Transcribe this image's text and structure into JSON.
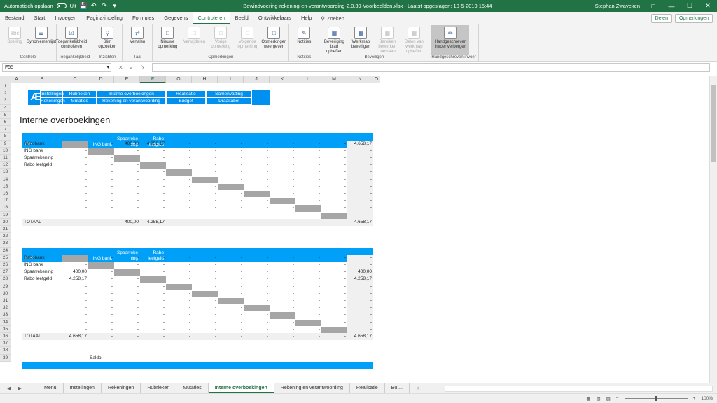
{
  "titlebar": {
    "autosave_label": "Automatisch opslaan",
    "autosave_state": "Uit",
    "file_title": "Bewindvoering-rekening-en-verantwoording-2.0.39-Voorbeelden.xlsx  -  Laatst opgeslagen: 10-5-2019 15:44",
    "user": "Stephan Zwaveken",
    "min": "—",
    "max": "☐",
    "close": "✕"
  },
  "menu": {
    "tabs": [
      "Bestand",
      "Start",
      "Invoegen",
      "Pagina-indeling",
      "Formules",
      "Gegevens",
      "Controleren",
      "Beeld",
      "Ontwikkelaars",
      "Help"
    ],
    "active": "Controleren",
    "search": "Zoeken",
    "share": "Delen",
    "comments": "Opmerkingen"
  },
  "ribbon": {
    "groups": [
      {
        "label": "Controle",
        "buttons": [
          {
            "label": "Spelling",
            "icon": "abc-icon",
            "disabled": true
          },
          {
            "label": "Synoniemenlijst",
            "icon": "book-icon"
          }
        ]
      },
      {
        "label": "Toegankelijkheid",
        "buttons": [
          {
            "label": "Toegankelijkheid controleren",
            "icon": "accessibility-icon"
          }
        ]
      },
      {
        "label": "Inzichten",
        "buttons": [
          {
            "label": "Slim opzoeken",
            "icon": "lookup-icon"
          }
        ]
      },
      {
        "label": "Taal",
        "buttons": [
          {
            "label": "Vertalen",
            "icon": "translate-icon"
          }
        ]
      },
      {
        "label": "Opmerkingen",
        "buttons": [
          {
            "label": "Nieuwe opmerking",
            "icon": "comment-icon"
          },
          {
            "label": "Verwijderen",
            "icon": "comment-icon",
            "disabled": true
          },
          {
            "label": "Vorige opmerking",
            "icon": "comment-icon",
            "disabled": true
          },
          {
            "label": "Volgende opmerking",
            "icon": "comment-icon",
            "disabled": true
          },
          {
            "label": "Opmerkingen weergeven",
            "icon": "comment-icon"
          }
        ]
      },
      {
        "label": "Notities",
        "buttons": [
          {
            "label": "Notities",
            "icon": "note-icon"
          }
        ]
      },
      {
        "label": "Beveiligen",
        "buttons": [
          {
            "label": "Beveiliging blad opheffen",
            "icon": "sheet-icon"
          },
          {
            "label": "Werkmap beveiligen",
            "icon": "sheet-icon"
          },
          {
            "label": "Bereiken bewerken toestaan",
            "icon": "sheet-icon",
            "disabled": true
          },
          {
            "label": "Delen van werkmap opheffen",
            "icon": "sheet-icon",
            "disabled": true
          }
        ]
      },
      {
        "label": "Handgeschreven invoer",
        "buttons": [
          {
            "label": "Handgeschreven invoer verbergen",
            "icon": "ink-icon",
            "selected": true
          }
        ]
      }
    ]
  },
  "formulabar": {
    "namebox": "F55",
    "cancel": "✕",
    "enter": "✓",
    "fx": "fx",
    "value": ""
  },
  "grid": {
    "columns": [
      "A",
      "B",
      "C",
      "D",
      "E",
      "F",
      "G",
      "H",
      "I",
      "J",
      "K",
      "L",
      "M",
      "N",
      "O"
    ],
    "selected_column": "F",
    "rows": [
      "1",
      "2",
      "3",
      "4",
      "5",
      "6",
      "7",
      "8",
      "9",
      "10",
      "11",
      "12",
      "13",
      "14",
      "15",
      "16",
      "17",
      "18",
      "19",
      "20",
      "21",
      "22",
      "23",
      "24",
      "25",
      "26",
      "27",
      "28",
      "29",
      "30",
      "31",
      "32",
      "33",
      "34",
      "35",
      "36",
      "37",
      "38",
      "39"
    ]
  },
  "nav": {
    "row2": [
      "Instellingen",
      "Rubrieken",
      "Interne overboekingen",
      "Realisatie",
      "Samenvatting"
    ],
    "row3": [
      "Rekeningen",
      "Mutaties",
      "Rekening en verantwoording",
      "Budget",
      "Draaitabel"
    ]
  },
  "sheet": {
    "title": "Interne overboekingen",
    "t1_caption": "Naar",
    "t2_caption": "Van",
    "t3_caption": "Saldo",
    "t1_corner": "Van",
    "t2_corner": "Naar",
    "headers": [
      "Rabobank",
      "ING bank",
      "Spaarreke\nning",
      "Rabo\nleefgeld",
      "TOTAAL"
    ],
    "accounts": [
      "Rabobank",
      "ING bank",
      "Spaarrekening",
      "Rabo leefgeld"
    ],
    "total_label": "TOTAAL",
    "dash": "-",
    "t1_rabobank_spaar": "400,00",
    "t1_rabobank_leefgeld": "4.258,17",
    "t1_rabobank_total": "4.658,17",
    "t1_total_spaar": "400,00",
    "t1_total_leefgeld": "4.258,17",
    "t1_total_total": "4.658,17",
    "t2_spaar_rabobank": "400,00",
    "t2_spaar_total": "400,00",
    "t2_leefgeld_rabobank": "4.258,17",
    "t2_leefgeld_total": "4.258,17",
    "t2_total_rabobank": "4.658,17",
    "t2_total_total": "4.658,17"
  },
  "sheettabs": {
    "tabs": [
      "Menu",
      "Instellingen",
      "Rekeningen",
      "Rubrieken",
      "Mutaties",
      "Interne overboekingen",
      "Rekening en verantwoording",
      "Realisatie",
      "Bu ..."
    ],
    "active": "Interne overboekingen",
    "add": "+"
  },
  "status": {
    "zoom": "100%"
  },
  "colors": {
    "excel_green": "#217346",
    "table_blue": "#00a0f8",
    "nav_blue": "#0090f0",
    "diag_gray": "#a6a6a6"
  }
}
